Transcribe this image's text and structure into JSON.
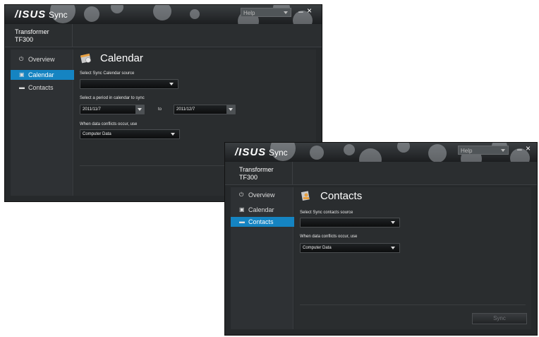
{
  "app": {
    "logo": "/ISUS",
    "title": "Sync",
    "help_label": "Help",
    "minimize": "–",
    "close": "×",
    "device_name_line1": "Transformer",
    "device_name_line2": "TF300"
  },
  "calendar_window": {
    "nav": [
      {
        "label": "Overview",
        "icon": "power-icon"
      },
      {
        "label": "Calendar",
        "icon": "calendar-icon"
      },
      {
        "label": "Contacts",
        "icon": "contacts-icon"
      }
    ],
    "active_nav": "Calendar",
    "section_title": "Calendar",
    "source_label": "Select Sync Calendar source",
    "source_value": "",
    "period_label": "Select a period in calendar to sync",
    "period_start": "2011/11/7",
    "period_to": "to",
    "period_end": "2011/12/7",
    "conflict_label": "When data conflicts occur, use",
    "conflict_value": "Computer Data"
  },
  "contacts_window": {
    "nav": [
      {
        "label": "Overview",
        "icon": "power-icon"
      },
      {
        "label": "Calendar",
        "icon": "calendar-icon"
      },
      {
        "label": "Contacts",
        "icon": "contacts-icon"
      }
    ],
    "active_nav": "Contacts",
    "section_title": "Contacts",
    "source_label": "Select Sync contacts source",
    "source_value": "",
    "conflict_label": "When data conflicts occur, use",
    "conflict_value": "Computer Data",
    "sync_button": "Sync"
  },
  "colors": {
    "accent": "#1584c2",
    "window_bg": "#26292b"
  }
}
